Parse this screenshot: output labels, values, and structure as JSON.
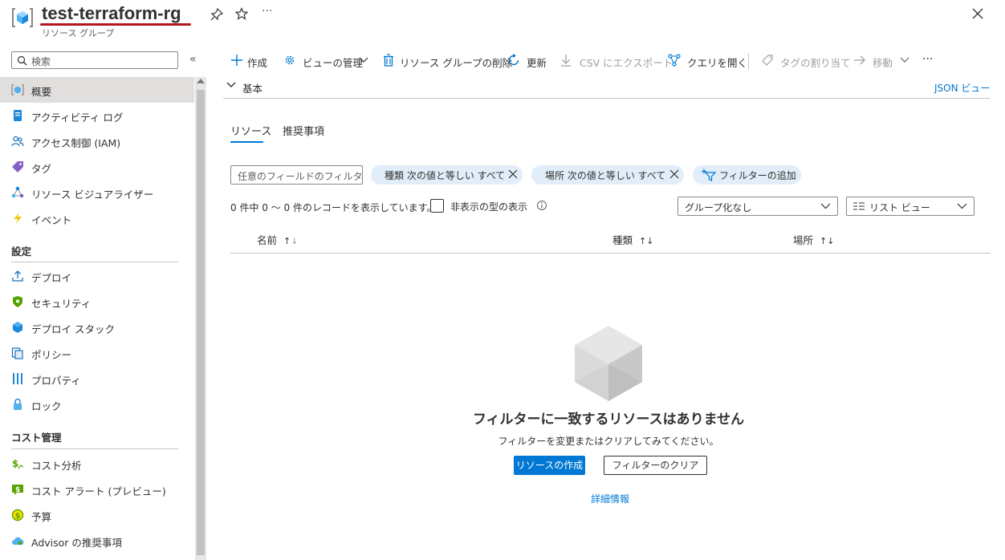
{
  "header": {
    "title": "test-terraform-rg",
    "subtitle": "リソース グループ",
    "more": "···"
  },
  "sidebar": {
    "search_placeholder": "検索",
    "collapse": "«",
    "items_top": [
      {
        "label": "概要",
        "icon": "resource-group-icon",
        "selected": true
      },
      {
        "label": "アクティビティ ログ",
        "icon": "activity-log-icon"
      },
      {
        "label": "アクセス制御 (IAM)",
        "icon": "iam-icon"
      },
      {
        "label": "タグ",
        "icon": "tag-icon"
      },
      {
        "label": "リソース ビジュアライザー",
        "icon": "visualizer-icon"
      },
      {
        "label": "イベント",
        "icon": "lightning-icon"
      }
    ],
    "section_settings": "設定",
    "items_settings": [
      {
        "label": "デプロイ",
        "icon": "deploy-icon"
      },
      {
        "label": "セキュリティ",
        "icon": "shield-icon"
      },
      {
        "label": "デプロイ スタック",
        "icon": "cube-stack-icon"
      },
      {
        "label": "ポリシー",
        "icon": "policy-icon"
      },
      {
        "label": "プロパティ",
        "icon": "properties-icon"
      },
      {
        "label": "ロック",
        "icon": "lock-icon"
      }
    ],
    "section_cost": "コスト管理",
    "items_cost": [
      {
        "label": "コスト分析",
        "icon": "cost-analysis-icon"
      },
      {
        "label": "コスト アラート (プレビュー)",
        "icon": "cost-alert-icon"
      },
      {
        "label": "予算",
        "icon": "budget-icon"
      },
      {
        "label": "Advisor の推奨事項",
        "icon": "advisor-icon"
      }
    ]
  },
  "toolbar": {
    "create": "作成",
    "manage_view": "ビューの管理",
    "delete_rg": "リソース グループの削除",
    "refresh": "更新",
    "export_csv": "CSV にエクスポート",
    "open_query": "クエリを開く",
    "assign_tags": "タグの割り当て",
    "move": "移動",
    "more": "···"
  },
  "essentials": {
    "label": "基本",
    "json_view": "JSON ビュー"
  },
  "tabs": [
    "リソース",
    "推奨事項"
  ],
  "filters": {
    "input_placeholder": "任意のフィールドのフィルター...",
    "pill_type": "種類 次の値と等しい すべて",
    "pill_location": "場所 次の値と等しい すべて",
    "add_filter": "フィルターの追加"
  },
  "records_text": "0 件中 0 ～ 0 件のレコードを表示しています。",
  "show_hidden": "非表示の型の表示",
  "grouping": "グループ化なし",
  "list_view": "リスト ビュー",
  "columns": [
    "名前",
    "種類",
    "場所"
  ],
  "empty": {
    "title": "フィルターに一致するリソースはありません",
    "subtitle": "フィルターを変更またはクリアしてみてください。",
    "create": "リソースの作成",
    "clear": "フィルターのクリア",
    "learn_more": "詳細情報"
  },
  "colors": {
    "accent": "#0078d4",
    "title_underline": "#b4161f",
    "pill_bg": "#e1eefa"
  }
}
